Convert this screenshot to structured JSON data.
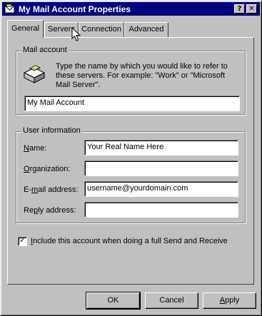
{
  "window": {
    "title": "My Mail Account Properties",
    "help_glyph": "?",
    "close_glyph": "✕"
  },
  "tabs": [
    {
      "label": "General",
      "active": true
    },
    {
      "label": "Servers",
      "active": false
    },
    {
      "label": "Connection",
      "active": false
    },
    {
      "label": "Advanced",
      "active": false
    }
  ],
  "mail_account": {
    "group_label": "Mail account",
    "description": "Type the name by which you would like to refer to these servers.  For example: \"Work\" or \"Microsoft Mail Server\".",
    "name_value": "My Mail Account",
    "icon": "mail-servers-icon"
  },
  "user_information": {
    "group_label": "User information",
    "name_key": "N",
    "name_rest": "ame:",
    "name_value": "Your Real Name Here",
    "org_key": "O",
    "org_rest": "rganization:",
    "org_value": "",
    "email_pre": "E-",
    "email_key": "m",
    "email_rest": "ail address:",
    "email_value": "username@yourdomain.com",
    "reply_pre": "Re",
    "reply_key": "p",
    "reply_rest": "ly address:",
    "reply_value": ""
  },
  "include_checkbox": {
    "checked": true,
    "check_glyph": "✓",
    "key": "I",
    "label_rest": "nclude this account when doing a full Send and Receive"
  },
  "buttons": {
    "ok": "OK",
    "cancel": "Cancel",
    "apply_key": "A",
    "apply_rest": "pply"
  },
  "colors": {
    "titlebar": "#000080",
    "face": "#c0c0c0"
  }
}
